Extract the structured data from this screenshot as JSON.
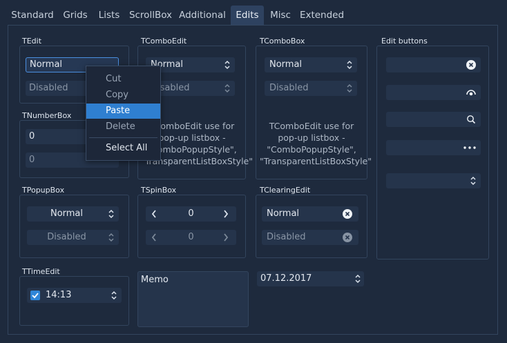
{
  "tabs": [
    {
      "label": "Standard"
    },
    {
      "label": "Grids"
    },
    {
      "label": "Lists"
    },
    {
      "label": "ScrollBox"
    },
    {
      "label": "Additional"
    },
    {
      "label": "Edits"
    },
    {
      "label": "Misc"
    },
    {
      "label": "Extended"
    }
  ],
  "active_tab": "Edits",
  "tedit": {
    "label": "TEdit",
    "value": "Normal",
    "disabled_value": "Disabled"
  },
  "tnumberbox": {
    "label": "TNumberBox",
    "value": "0",
    "disabled_value": "0"
  },
  "tpopupbox": {
    "label": "TPopupBox",
    "value": "Normal",
    "disabled_value": "Disabled"
  },
  "ttimeedit": {
    "label": "TTimeEdit",
    "value": "14:13",
    "checked": true
  },
  "tcomboedit": {
    "label": "TComboEdit",
    "value": "Normal",
    "disabled_value": "Disabled",
    "note": "TComboEdit use for pop-up listbox - \"ComboPopupStyle\", \"TransparentListBoxStyle\""
  },
  "tcombobox": {
    "label": "TComboBox",
    "value": "Normal",
    "disabled_value": "Disabled",
    "note": "TComboEdit use for pop-up listbox - \"ComboPopupStyle\", \"TransparentListBoxStyle\""
  },
  "tspinbox": {
    "label": "TSpinBox",
    "value": "0",
    "disabled_value": "0"
  },
  "tclearingedit": {
    "label": "TClearingEdit",
    "value": "Normal",
    "disabled_value": "Disabled"
  },
  "memo": {
    "text": "Memo"
  },
  "dateedit": {
    "value": "07.12.2017"
  },
  "edit_buttons": {
    "label": "Edit buttons",
    "icons": [
      "clear-icon",
      "password-eye-icon",
      "search-icon",
      "ellipsis-icon",
      "spin-arrows-icon"
    ]
  },
  "context_menu": {
    "items": [
      {
        "label": "Cut",
        "enabled": false
      },
      {
        "label": "Copy",
        "enabled": false
      },
      {
        "label": "Paste",
        "enabled": true,
        "selected": true
      },
      {
        "label": "Delete",
        "enabled": false
      },
      {
        "label": "Select All",
        "enabled": true
      }
    ]
  },
  "colors": {
    "background": "#1e2a3d",
    "field": "#25344b",
    "accent": "#2f7fd0",
    "border": "#33455e"
  }
}
